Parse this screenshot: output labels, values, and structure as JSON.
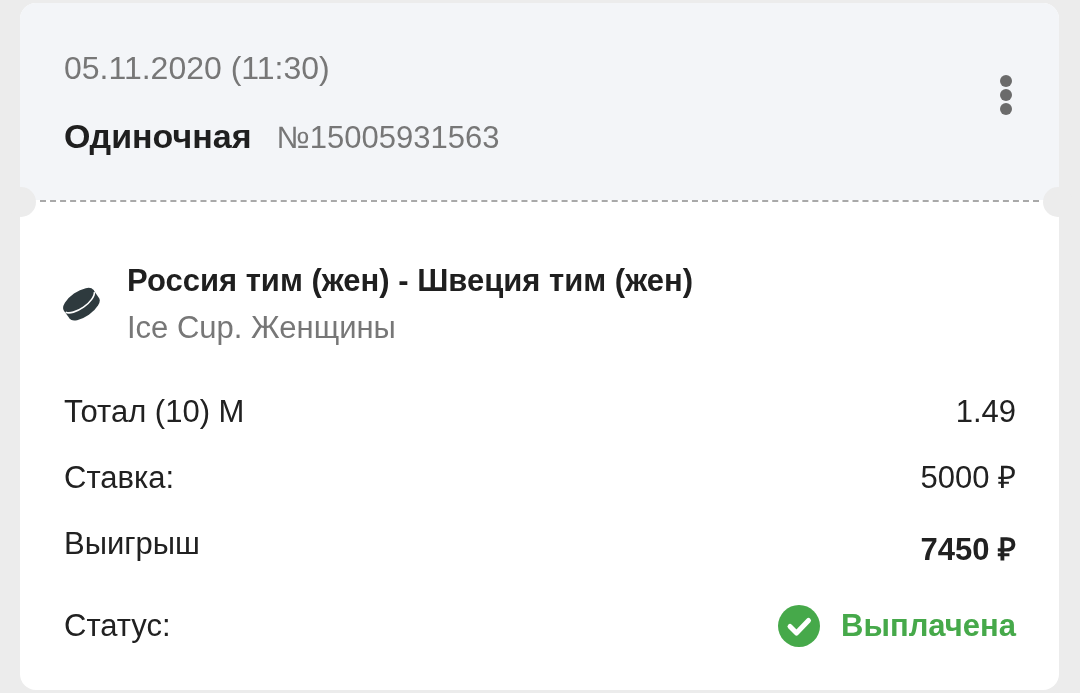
{
  "bet": {
    "date": "05.11.2020 (11:30)",
    "type": "Одиночная",
    "number": "№15005931563"
  },
  "event": {
    "teams": "Россия тим (жен) - Швеция тим (жен)",
    "tournament": "Ice Cup. Женщины"
  },
  "details": [
    {
      "kind": "plain",
      "label": "Тотал (10) М",
      "value": "1.49"
    },
    {
      "kind": "plain",
      "label": "Ставка:",
      "value": "5000 ₽"
    },
    {
      "kind": "total",
      "label": "Выигрыш",
      "value": "7450 ₽"
    },
    {
      "kind": "status",
      "label": "Статус:",
      "value": "Выплачена"
    }
  ]
}
